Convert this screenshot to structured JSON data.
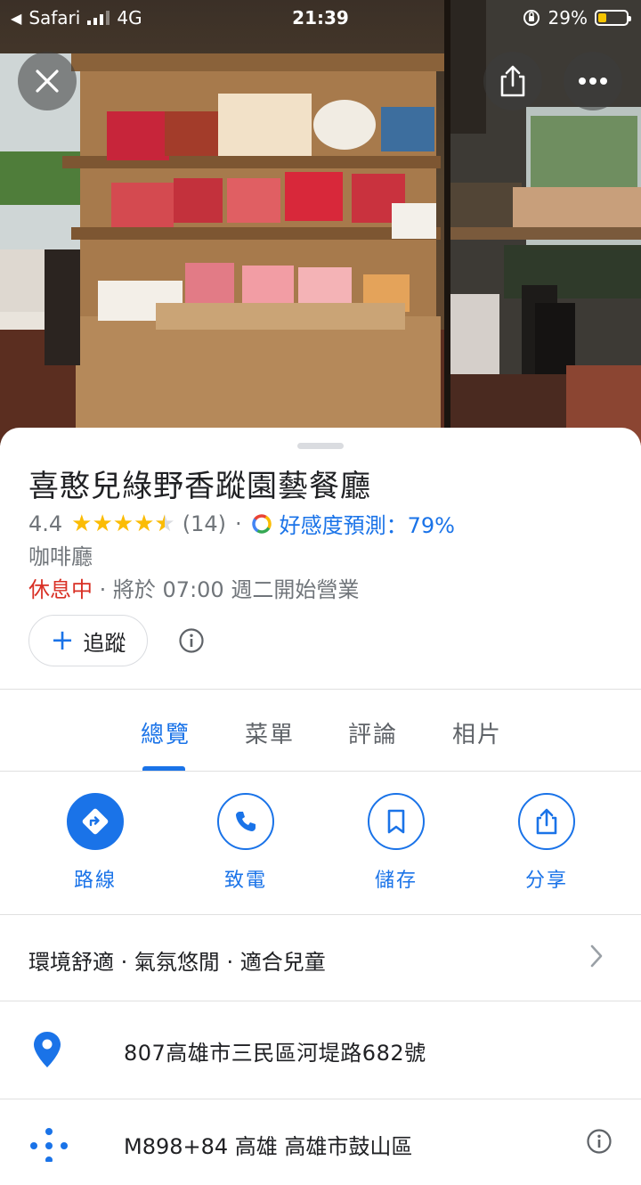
{
  "status_bar": {
    "carrier": "Safari",
    "network": "4G",
    "time": "21:39",
    "battery": "29%",
    "battery_level": 0.29
  },
  "place": {
    "name": "喜憨兒綠野香蹤園藝餐廳",
    "rating": "4.4",
    "stars": 4.4,
    "review_count": "(14)",
    "match_label": "好感度預測：79%",
    "category": "咖啡廳",
    "status": "休息中",
    "hours_note": "· 將於 07:00 週二開始營業"
  },
  "follow_button": {
    "label": "追蹤"
  },
  "tabs": [
    {
      "label": "總覽",
      "active": true
    },
    {
      "label": "菜單",
      "active": false
    },
    {
      "label": "評論",
      "active": false
    },
    {
      "label": "相片",
      "active": false
    }
  ],
  "actions": [
    {
      "label": "路線",
      "icon": "directions-icon"
    },
    {
      "label": "致電",
      "icon": "phone-icon"
    },
    {
      "label": "儲存",
      "icon": "bookmark-icon"
    },
    {
      "label": "分享",
      "icon": "share-icon"
    }
  ],
  "highlights": "環境舒適 · 氣氛悠閒 · 適合兒童",
  "address": "807高雄市三民區河堤路682號",
  "plus_code": "M898+84 高雄 高雄市鼓山區",
  "colors": {
    "accent": "#1a73e8",
    "closed": "#d93025",
    "star": "#fbbc04"
  }
}
